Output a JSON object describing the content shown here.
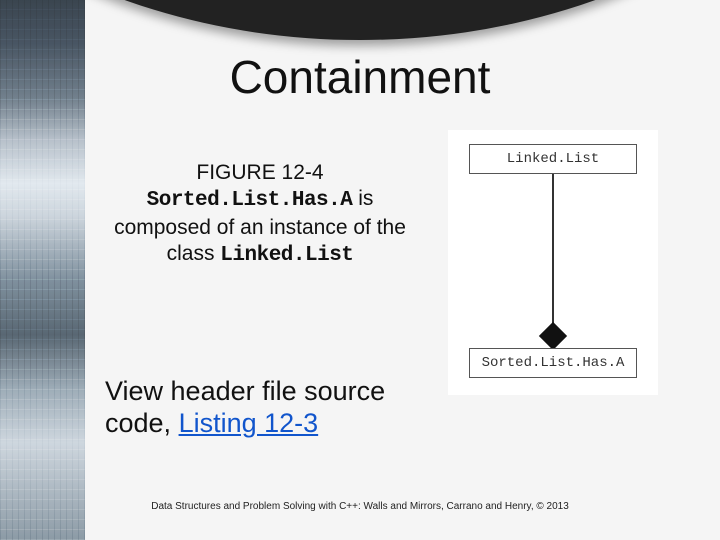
{
  "title": "Containment",
  "caption": {
    "figure_label": "FIGURE 12-4",
    "code_subject": "Sorted.List.Has.A",
    "mid_text": " is composed of an instance of the class ",
    "code_object": "Linked.List"
  },
  "bottom": {
    "lead": "View header file source code, ",
    "link_text": "Listing 12-3"
  },
  "footer": "Data Structures and Problem Solving with C++: Walls and Mirrors, Carrano and Henry, ©  2013",
  "uml": {
    "top_class": "Linked.List",
    "bottom_class": "Sorted.List.Has.A"
  }
}
